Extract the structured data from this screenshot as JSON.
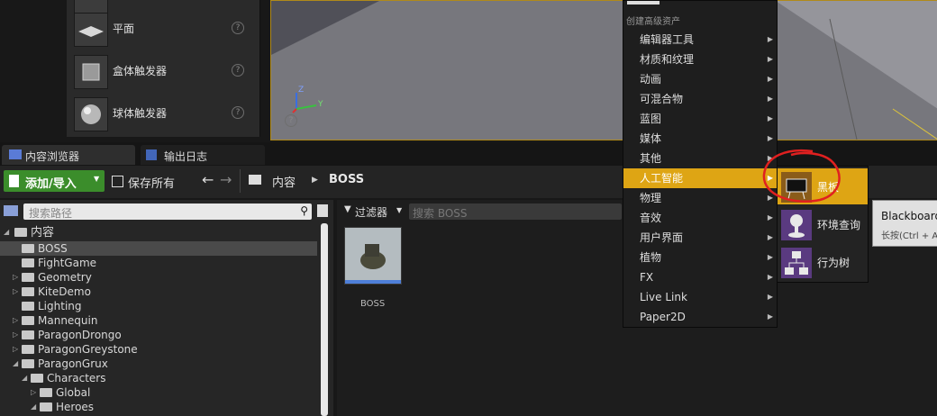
{
  "shapes": [
    {
      "label": "平面",
      "icon": "plane-shape-icon"
    },
    {
      "label": "盒体触发器",
      "icon": "box-trigger-icon"
    },
    {
      "label": "球体触发器",
      "icon": "sphere-trigger-icon"
    }
  ],
  "help_glyph": "?",
  "viewport": {
    "axis_z": "Z",
    "axis_y": "Y"
  },
  "tabs": [
    {
      "label": "内容浏览器"
    },
    {
      "label": "输出日志"
    }
  ],
  "toolbar": {
    "add_import": "添加/导入",
    "save_all": "保存所有",
    "breadcrumb_root": "内容",
    "breadcrumb_current": "BOSS"
  },
  "search_path": {
    "placeholder": "搜索路径"
  },
  "filter": {
    "label": "过滤器",
    "search_placeholder": "搜索 BOSS"
  },
  "tree": [
    {
      "label": "内容",
      "level": 0,
      "expanded": true
    },
    {
      "label": "BOSS",
      "level": 1,
      "selected": true
    },
    {
      "label": "FightGame",
      "level": 1
    },
    {
      "label": "Geometry",
      "level": 1,
      "collapsed": true
    },
    {
      "label": "KiteDemo",
      "level": 1,
      "collapsed": true
    },
    {
      "label": "Lighting",
      "level": 1
    },
    {
      "label": "Mannequin",
      "level": 1,
      "collapsed": true
    },
    {
      "label": "ParagonDrongo",
      "level": 1,
      "collapsed": true
    },
    {
      "label": "ParagonGreystone",
      "level": 1,
      "collapsed": true
    },
    {
      "label": "ParagonGrux",
      "level": 1,
      "expanded": true
    },
    {
      "label": "Characters",
      "level": 2,
      "expanded": true
    },
    {
      "label": "Global",
      "level": 3,
      "collapsed": true
    },
    {
      "label": "Heroes",
      "level": 3,
      "expanded": true
    }
  ],
  "assets": [
    {
      "label": "BOSS"
    }
  ],
  "context_menu": {
    "header": "创建高级资产",
    "items": [
      {
        "label": "编辑器工具"
      },
      {
        "label": "材质和纹理"
      },
      {
        "label": "动画"
      },
      {
        "label": "可混合物"
      },
      {
        "label": "蓝图"
      },
      {
        "label": "媒体"
      },
      {
        "label": "其他"
      },
      {
        "label": "人工智能",
        "highlighted": true
      },
      {
        "label": "物理"
      },
      {
        "label": "音效"
      },
      {
        "label": "用户界面"
      },
      {
        "label": "植物"
      },
      {
        "label": "FX"
      },
      {
        "label": "Live Link"
      },
      {
        "label": "Paper2D"
      }
    ]
  },
  "submenu": [
    {
      "label": "黑板",
      "icon": "blackboard-icon",
      "highlighted": true
    },
    {
      "label": "环境查询",
      "icon": "environment-query-icon"
    },
    {
      "label": "行为树",
      "icon": "behavior-tree-icon"
    }
  ],
  "tooltip": {
    "title": "Blackboard",
    "hint": "长按(Ctrl + A"
  },
  "colors": {
    "accent": "#dea514",
    "add_button": "#3b8d2b",
    "annotation": "#e02020"
  }
}
